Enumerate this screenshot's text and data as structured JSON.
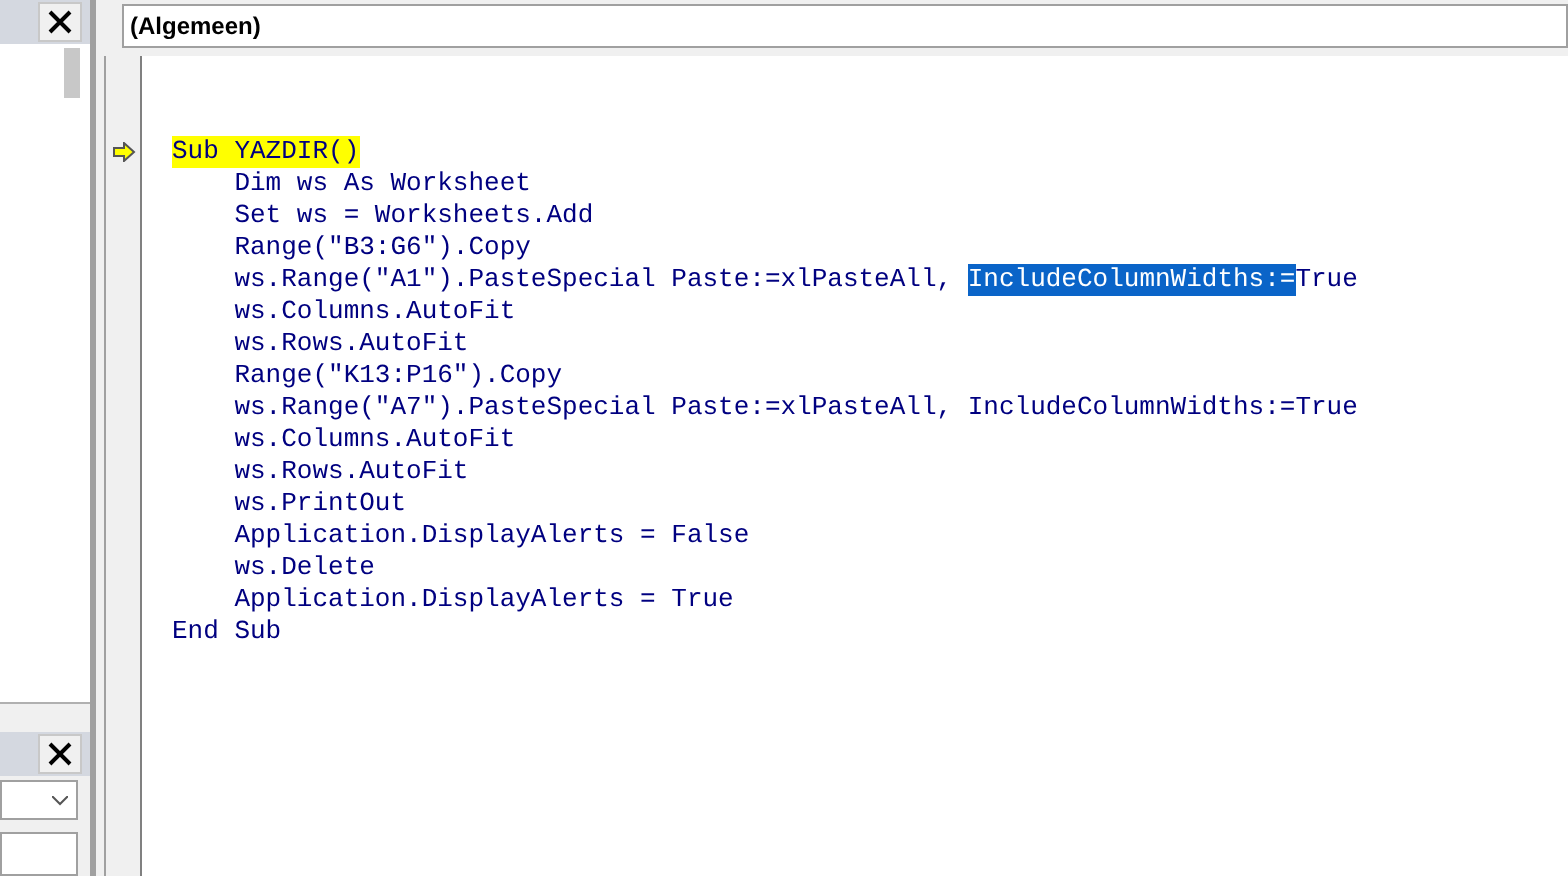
{
  "object_dropdown": {
    "value": "(Algemeen)"
  },
  "code_lines": [
    {
      "current": true,
      "segments": [
        {
          "text": "Sub YAZDIR()",
          "selected": false
        }
      ]
    },
    {
      "current": false,
      "segments": [
        {
          "text": "    Dim ws As Worksheet",
          "selected": false
        }
      ]
    },
    {
      "current": false,
      "segments": [
        {
          "text": "    Set ws = Worksheets.Add",
          "selected": false
        }
      ]
    },
    {
      "current": false,
      "segments": [
        {
          "text": "    Range(\"B3:G6\").Copy",
          "selected": false
        }
      ]
    },
    {
      "current": false,
      "segments": [
        {
          "text": "    ws.Range(\"A1\").PasteSpecial Paste:=xlPasteAll, ",
          "selected": false
        },
        {
          "text": "IncludeColumnWidths:=",
          "selected": true
        },
        {
          "text": "True",
          "selected": false
        }
      ]
    },
    {
      "current": false,
      "segments": [
        {
          "text": "    ws.Columns.AutoFit",
          "selected": false
        }
      ]
    },
    {
      "current": false,
      "segments": [
        {
          "text": "    ws.Rows.AutoFit",
          "selected": false
        }
      ]
    },
    {
      "current": false,
      "segments": [
        {
          "text": "    Range(\"K13:P16\").Copy",
          "selected": false
        }
      ]
    },
    {
      "current": false,
      "segments": [
        {
          "text": "    ws.Range(\"A7\").PasteSpecial Paste:=xlPasteAll, IncludeColumnWidths:=True",
          "selected": false
        }
      ]
    },
    {
      "current": false,
      "segments": [
        {
          "text": "    ws.Columns.AutoFit",
          "selected": false
        }
      ]
    },
    {
      "current": false,
      "segments": [
        {
          "text": "    ws.Rows.AutoFit",
          "selected": false
        }
      ]
    },
    {
      "current": false,
      "segments": [
        {
          "text": "    ws.PrintOut",
          "selected": false
        }
      ]
    },
    {
      "current": false,
      "segments": [
        {
          "text": "    Application.DisplayAlerts = False",
          "selected": false
        }
      ]
    },
    {
      "current": false,
      "segments": [
        {
          "text": "    ws.Delete",
          "selected": false
        }
      ]
    },
    {
      "current": false,
      "segments": [
        {
          "text": "    Application.DisplayAlerts = True",
          "selected": false
        }
      ]
    },
    {
      "current": false,
      "segments": [
        {
          "text": "End Sub",
          "selected": false
        }
      ]
    }
  ]
}
